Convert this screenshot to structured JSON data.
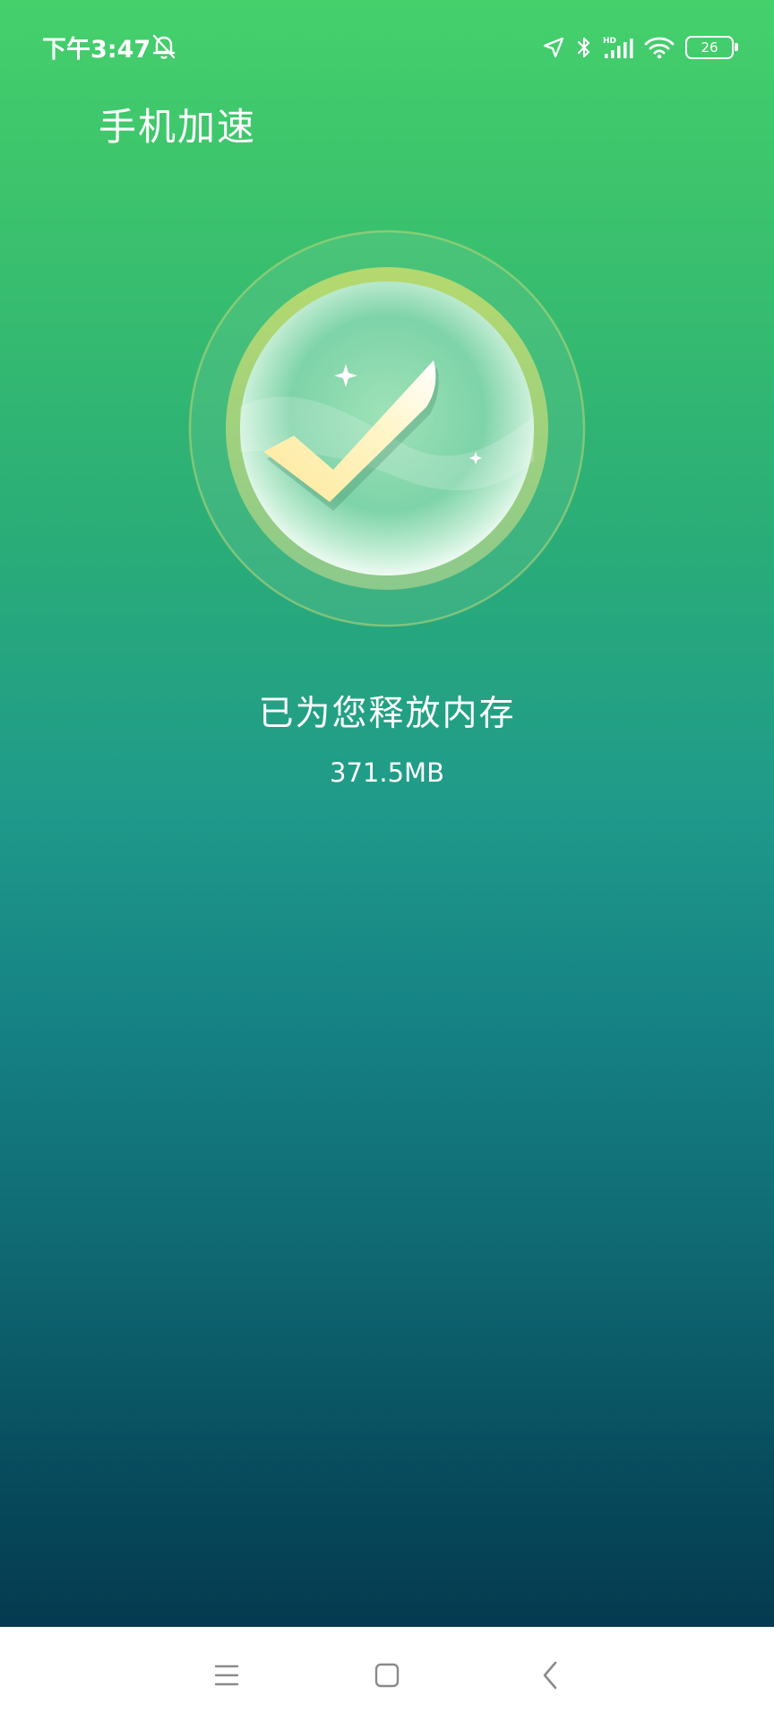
{
  "status_bar": {
    "time": "下午3:47",
    "battery_level": "26",
    "icons": [
      "alarm-off-icon",
      "location-arrow-icon",
      "bluetooth-icon",
      "hd-signal-icon",
      "wifi-icon",
      "battery-icon"
    ]
  },
  "header": {
    "title": "手机加速"
  },
  "result": {
    "message": "已为您释放内存",
    "value": "371.5MB",
    "icon": "check-success-icon"
  },
  "nav_bar": {
    "icons": [
      "menu-icon",
      "home-icon",
      "back-icon"
    ]
  },
  "colors": {
    "gradient_top": "#45d06c",
    "gradient_bottom": "#053a4f",
    "text": "#ffffff",
    "check_fill": "#fff4c2",
    "nav_icon": "#8a8a8a"
  }
}
